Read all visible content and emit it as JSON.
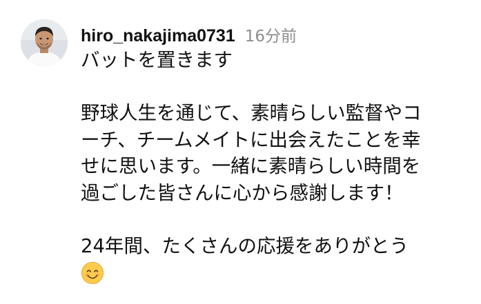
{
  "comment": {
    "username": "hiro_nakajima0731",
    "timestamp": "16分前",
    "lines": [
      "バットを置きます",
      "",
      "野球人生を通じて、素晴らしい監督やコ",
      "ーチ、チームメイトに出会えたことを幸",
      "せに思います。一緒に素晴らしい時間を",
      "過ごした皆さんに心から感謝します！",
      "",
      "24年間、たくさんの応援をありがとう"
    ],
    "emoji": "smiling-face-with-smiling-eyes"
  },
  "colors": {
    "text": "#111111",
    "timestamp": "#8e8e8e",
    "background": "#ffffff",
    "emoji_face": "#ffcb4c"
  }
}
